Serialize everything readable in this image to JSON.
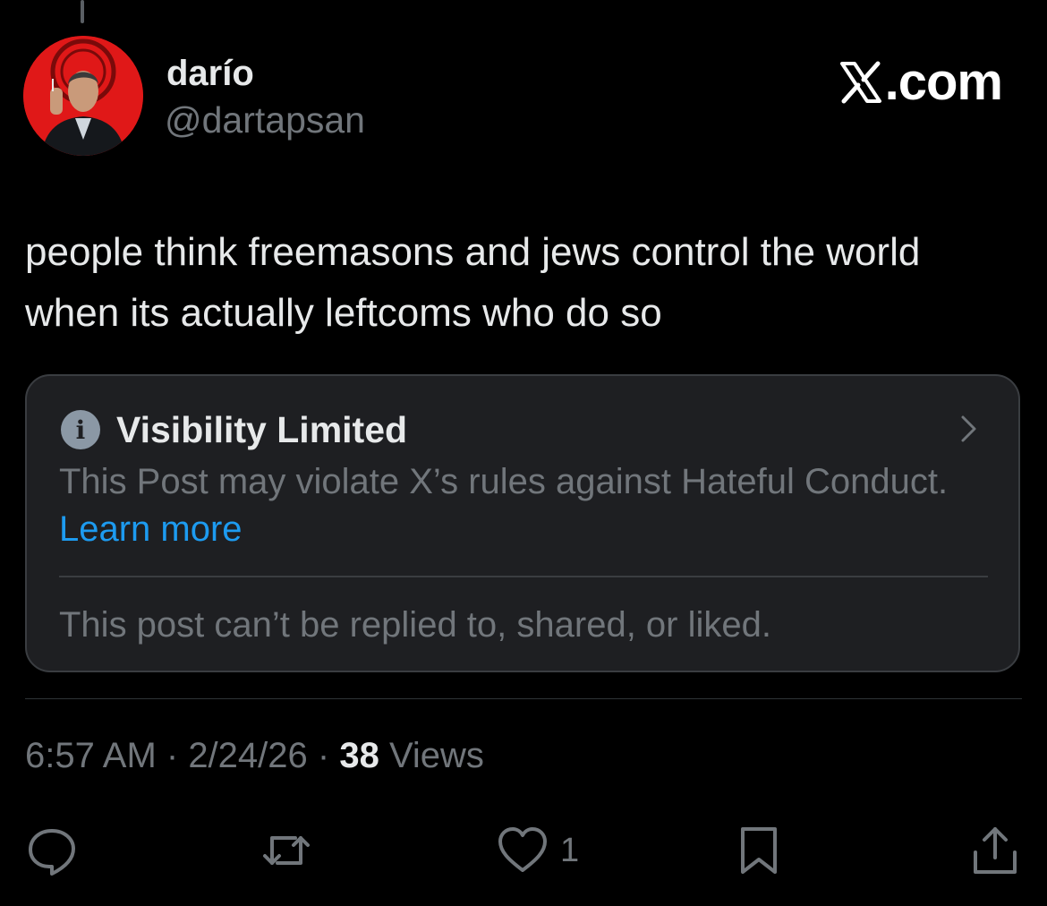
{
  "author": {
    "name": "darío",
    "handle": "@dartapsan"
  },
  "brand": {
    "label": ".com"
  },
  "post": {
    "text": "people think freemasons and jews control the world when its actually leftcoms who do so"
  },
  "notice": {
    "title": "Visibility Limited",
    "body": "This Post may violate X’s rules against Hateful Conduct.",
    "link_label": "Learn more",
    "footer": "This post can’t be replied to, shared, or liked."
  },
  "meta": {
    "time": "6:57 AM",
    "separator": " · ",
    "date": "2/24/26",
    "views_count": "38",
    "views_label": "Views"
  },
  "actions": {
    "like_count": "1"
  },
  "icons": {
    "info": "info-icon",
    "chevron": "chevron-right-icon",
    "reply": "reply-icon",
    "repost": "repost-icon",
    "like": "heart-icon",
    "bookmark": "bookmark-icon",
    "share": "share-icon"
  },
  "colors": {
    "background": "#000000",
    "primary_text": "#e7e9ea",
    "secondary_text": "#71767b",
    "link": "#1d9bf0",
    "notice_background": "#1e1f22",
    "notice_border": "#3a3d41",
    "avatar_background": "#e01818"
  }
}
